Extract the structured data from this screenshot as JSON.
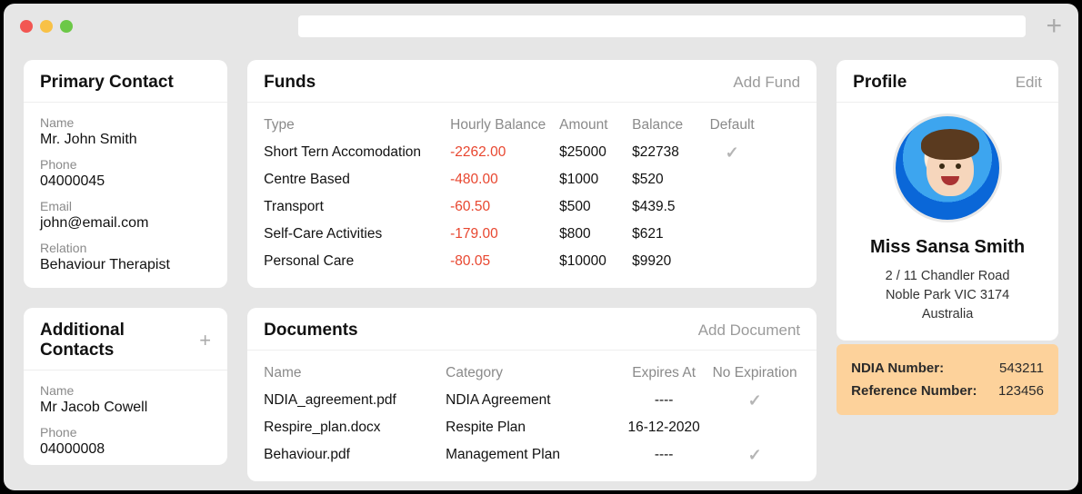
{
  "primaryContact": {
    "title": "Primary Contact",
    "name_label": "Name",
    "name": "Mr. John Smith",
    "phone_label": "Phone",
    "phone": "04000045",
    "email_label": "Email",
    "email": "john@email.com",
    "relation_label": "Relation",
    "relation": "Behaviour Therapist"
  },
  "additionalContacts": {
    "title": "Additional Contacts",
    "items": [
      {
        "name_label": "Name",
        "name": "Mr Jacob Cowell",
        "phone_label": "Phone",
        "phone": "04000008"
      }
    ]
  },
  "funds": {
    "title": "Funds",
    "action": "Add Fund",
    "headers": {
      "type": "Type",
      "hourly": "Hourly Balance",
      "amount": "Amount",
      "balance": "Balance",
      "default": "Default"
    },
    "rows": [
      {
        "type": "Short Tern Accomodation",
        "hourly": "-2262.00",
        "amount": "$25000",
        "balance": "$22738",
        "default": true
      },
      {
        "type": "Centre Based",
        "hourly": "-480.00",
        "amount": "$1000",
        "balance": "$520",
        "default": false
      },
      {
        "type": "Transport",
        "hourly": "-60.50",
        "amount": "$500",
        "balance": "$439.5",
        "default": false
      },
      {
        "type": "Self-Care Activities",
        "hourly": "-179.00",
        "amount": "$800",
        "balance": "$621",
        "default": false
      },
      {
        "type": "Personal Care",
        "hourly": "-80.05",
        "amount": "$10000",
        "balance": "$9920",
        "default": false
      }
    ]
  },
  "documents": {
    "title": "Documents",
    "action": "Add Document",
    "headers": {
      "name": "Name",
      "category": "Category",
      "expires": "Expires At",
      "noexp": "No Expiration"
    },
    "rows": [
      {
        "name": "NDIA_agreement.pdf",
        "category": "NDIA Agreement",
        "expires": "----",
        "noexp": true
      },
      {
        "name": "Respire_plan.docx",
        "category": "Respite Plan",
        "expires": "16-12-2020",
        "noexp": false
      },
      {
        "name": "Behaviour.pdf",
        "category": "Management Plan",
        "expires": "----",
        "noexp": true
      }
    ]
  },
  "profile": {
    "title": "Profile",
    "action": "Edit",
    "name": "Miss Sansa Smith",
    "addr1": "2 / 11 Chandler Road",
    "addr2": "Noble Park VIC 3174",
    "addr3": "Australia",
    "meta": {
      "ndia_label": "NDIA Number:",
      "ndia_value": "543211",
      "ref_label": "Reference Number:",
      "ref_value": "123456"
    }
  }
}
